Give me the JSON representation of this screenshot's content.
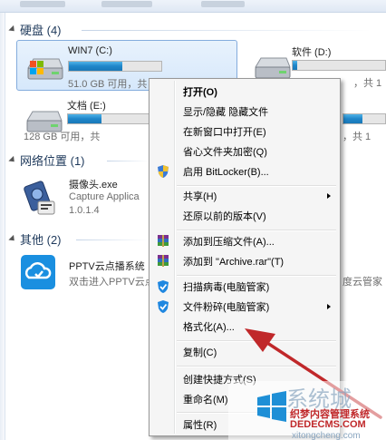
{
  "sections": {
    "drives": "硬盘 (4)",
    "network": "网络位置 (1)",
    "other": "其他 (2)"
  },
  "drives": [
    {
      "name": "WIN7 (C:)",
      "info": "51.0 GB 可用，共 1",
      "fill": 0.58
    },
    {
      "name": "软件 (D:)",
      "info": "，共 1",
      "fill": 0.05
    },
    {
      "name": "文档 (E:)",
      "info": "128 GB 可用，共",
      "fill": 0.4
    },
    {
      "name": "",
      "info": "，共 1",
      "fill": 0.45
    }
  ],
  "network_items": [
    {
      "name": "摄像头.exe",
      "sub1": "Capture Applica",
      "sub2": "1.0.1.4"
    }
  ],
  "other_items": [
    {
      "name": "PPTV云点播系统",
      "sub": "双击进入PPTV云点",
      "right_name": "",
      "right_sub": "度云管家"
    }
  ],
  "context_menu": {
    "items": [
      {
        "label": "打开(O)",
        "bold": true
      },
      {
        "label": "显示/隐藏 隐藏文件"
      },
      {
        "label": "在新窗口中打开(E)"
      },
      {
        "label": "省心文件夹加密(Q)"
      },
      {
        "label": "启用 BitLocker(B)...",
        "icon": "uac-shield-icon"
      },
      {
        "label": "共享(H)",
        "submenu": true
      },
      {
        "label": "还原以前的版本(V)"
      },
      {
        "label": "添加到压缩文件(A)...",
        "icon": "winrar-icon"
      },
      {
        "label": "添加到 \"Archive.rar\"(T)",
        "icon": "winrar-icon"
      },
      {
        "label": "扫描病毒(电脑管家)",
        "icon": "tencent-shield-icon"
      },
      {
        "label": "文件粉碎(电脑管家)",
        "icon": "tencent-shield-icon",
        "submenu": true
      },
      {
        "label": "格式化(A)..."
      },
      {
        "label": "复制(C)"
      },
      {
        "label": "创建快捷方式(S)"
      },
      {
        "label": "重命名(M)"
      },
      {
        "label": "属性(R)"
      }
    ]
  },
  "watermark": {
    "title": "系统城",
    "line1": "织梦内容管理系统",
    "line2": "DEDECMS.COM",
    "url": "xitongcheng.com"
  },
  "colors": {
    "bar_fill": "#1f86c9",
    "arrow": "#c0282a",
    "section_text": "#1e395b"
  }
}
